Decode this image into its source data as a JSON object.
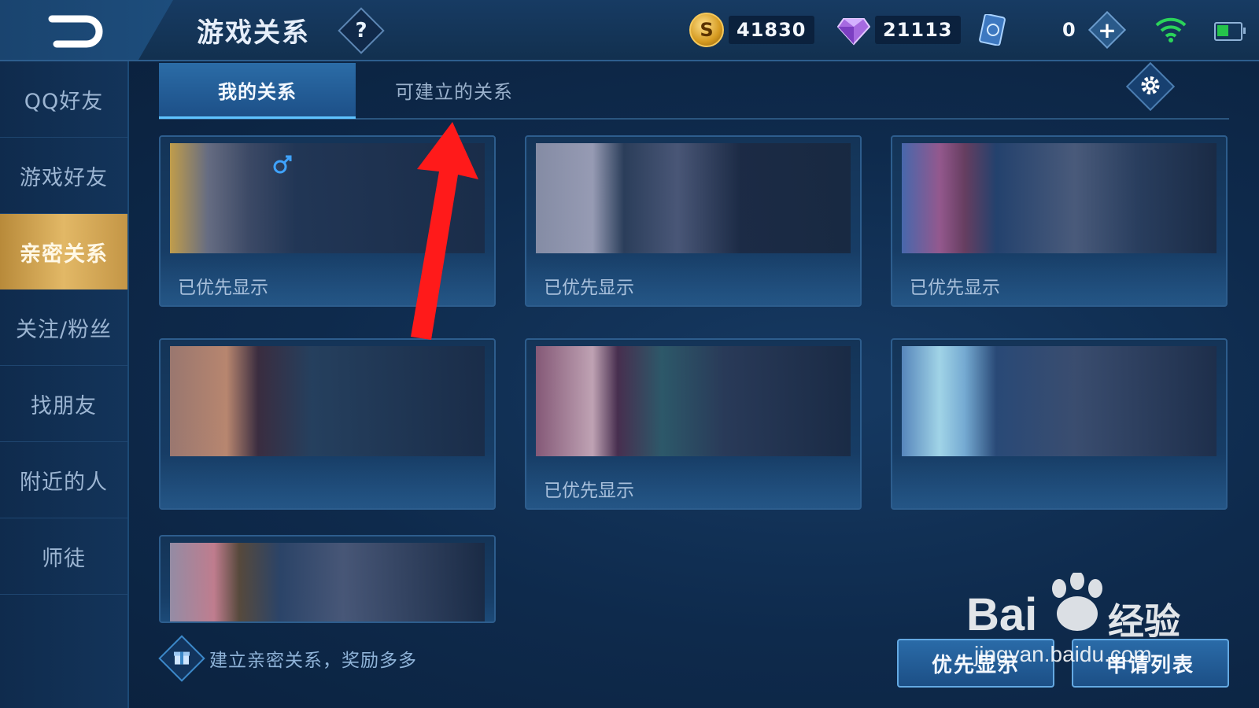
{
  "header": {
    "title": "游戏关系",
    "help_label": "?",
    "gold": "41830",
    "diamonds": "21113",
    "tickets": "0",
    "plus_label": "+"
  },
  "sidebar": {
    "items": [
      {
        "label": "QQ好友"
      },
      {
        "label": "游戏好友"
      },
      {
        "label": "亲密关系"
      },
      {
        "label": "关注/粉丝"
      },
      {
        "label": "找朋友"
      },
      {
        "label": "附近的人"
      },
      {
        "label": "师徒"
      }
    ],
    "active_index": 2
  },
  "tabs": [
    {
      "label": "我的关系"
    },
    {
      "label": "可建立的关系"
    }
  ],
  "cards": [
    {
      "status": "已优先显示"
    },
    {
      "status": "已优先显示"
    },
    {
      "status": "已优先显示"
    },
    {
      "status": ""
    },
    {
      "status": "已优先显示"
    },
    {
      "status": ""
    },
    {
      "status": ""
    }
  ],
  "footer": {
    "tip": "建立亲密关系，奖励多多",
    "priority_button": "优先显示",
    "apply_list_button": "申请列表"
  },
  "watermark": {
    "brand": "Bai",
    "brand_cn": "经验",
    "url": "jingyan.baidu.com"
  },
  "colors": {
    "accent": "#5fc3ff",
    "active_gold": "#e2b866",
    "arrow": "#ff1a1a",
    "background": "#0e2a4c"
  }
}
